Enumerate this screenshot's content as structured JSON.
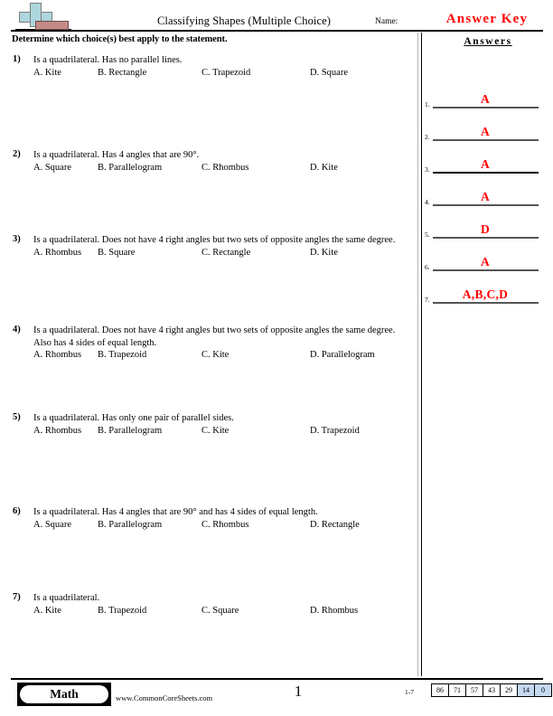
{
  "header": {
    "logo_icon": "plus-block-logo",
    "title": "Classifying Shapes (Multiple Choice)",
    "name_label": "Name:",
    "answer_key_text": "Answer Key"
  },
  "instruction": "Determine which choice(s) best apply to the statement.",
  "questions": [
    {
      "number": "1)",
      "stem": "Is a quadrilateral. Has no parallel lines.",
      "choices": [
        "A. Kite",
        "B. Rectangle",
        "C. Trapezoid",
        "D. Square"
      ]
    },
    {
      "number": "2)",
      "stem": "Is a quadrilateral. Has 4 angles that are 90°.",
      "choices": [
        "A. Square",
        "B. Parallelogram",
        "C. Rhombus",
        "D. Kite"
      ]
    },
    {
      "number": "3)",
      "stem": "Is a quadrilateral. Does not have 4 right angles but two sets of opposite angles the same degree.",
      "choices": [
        "A. Rhombus",
        "B. Square",
        "C. Rectangle",
        "D. Kite"
      ]
    },
    {
      "number": "4)",
      "stem": "Is a quadrilateral. Does not have 4 right angles but two sets of opposite angles the same degree. Also has 4 sides of equal length.",
      "choices": [
        "A. Rhombus",
        "B. Trapezoid",
        "C. Kite",
        "D. Parallelogram"
      ]
    },
    {
      "number": "5)",
      "stem": "Is a quadrilateral. Has only one pair of parallel sides.",
      "choices": [
        "A. Rhombus",
        "B. Parallelogram",
        "C. Kite",
        "D. Trapezoid"
      ]
    },
    {
      "number": "6)",
      "stem": "Is a quadrilateral. Has 4 angles that are 90° and has 4 sides of equal length.",
      "choices": [
        "A. Square",
        "B. Parallelogram",
        "C. Rhombus",
        "D. Rectangle"
      ]
    },
    {
      "number": "7)",
      "stem": "Is a quadrilateral.",
      "choices": [
        "A. Kite",
        "B. Trapezoid",
        "C. Square",
        "D. Rhombus"
      ]
    }
  ],
  "answers_panel": {
    "title": "Answers",
    "rows": [
      {
        "num": "1.",
        "value": "A"
      },
      {
        "num": "2.",
        "value": "A"
      },
      {
        "num": "3.",
        "value": "A"
      },
      {
        "num": "4.",
        "value": "A"
      },
      {
        "num": "5.",
        "value": "D"
      },
      {
        "num": "6.",
        "value": "A"
      },
      {
        "num": "7.",
        "value": "A,B,C,D"
      }
    ]
  },
  "footer": {
    "subject_badge": "Math",
    "site_url": "www.CommonCoreSheets.com",
    "page_number": "1",
    "range_label": "1-7",
    "score_scale": [
      {
        "value": "86",
        "highlighted": false
      },
      {
        "value": "71",
        "highlighted": false
      },
      {
        "value": "57",
        "highlighted": false
      },
      {
        "value": "43",
        "highlighted": false
      },
      {
        "value": "29",
        "highlighted": false
      },
      {
        "value": "14",
        "highlighted": true
      },
      {
        "value": "0",
        "highlighted": true
      }
    ]
  },
  "colors": {
    "answer_red": "#ff0000",
    "logo_blue": "#aed6de",
    "logo_red": "#c38a88",
    "highlight_blue": "#c5d9f1"
  }
}
